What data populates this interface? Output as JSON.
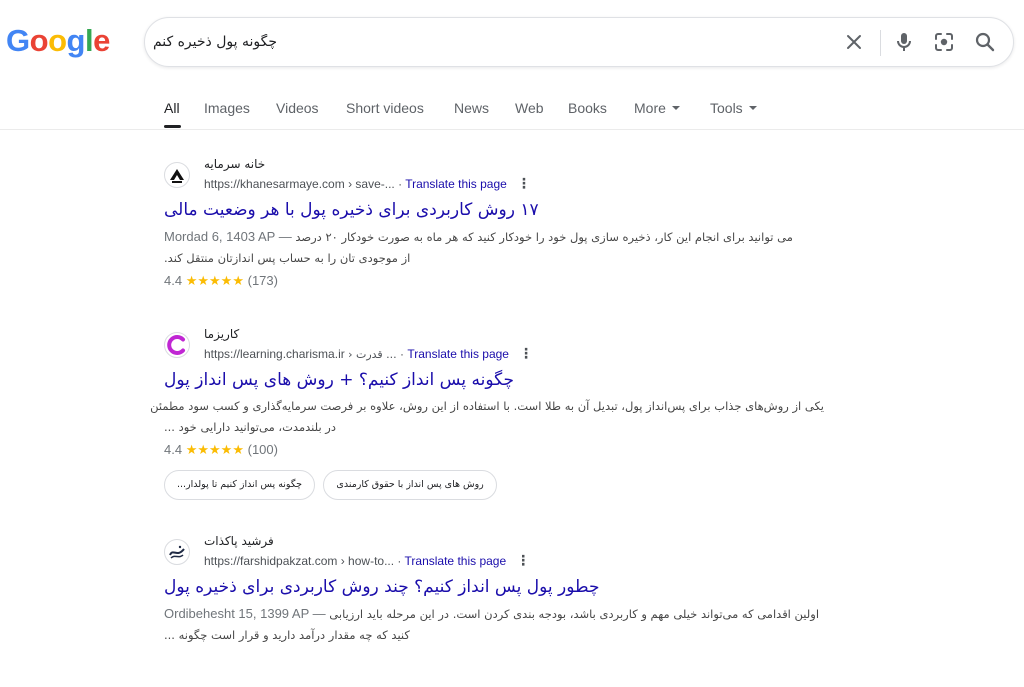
{
  "logo": {
    "text": "Google",
    "letters": [
      "G",
      "o",
      "o",
      "g",
      "l",
      "e"
    ],
    "colors": [
      "#4285F4",
      "#EA4335",
      "#FBBC05",
      "#4285F4",
      "#34A853",
      "#EA4335"
    ]
  },
  "search": {
    "query": "چگونه پول ذخیره کنم"
  },
  "icons": {
    "clear": "close-icon",
    "voice": "mic-icon",
    "lens": "camera-lens-icon",
    "search": "search-icon"
  },
  "tabs": [
    {
      "label": "All",
      "active": true
    },
    {
      "label": "Images"
    },
    {
      "label": "Videos"
    },
    {
      "label": "Short videos"
    },
    {
      "label": "News"
    },
    {
      "label": "Web"
    },
    {
      "label": "Books"
    },
    {
      "label": "More"
    },
    {
      "label": "Tools"
    }
  ],
  "results": [
    {
      "site_name": "خانه سرمایه",
      "url": "https://khanesarmaye.com › save-...",
      "translate": "Translate this page",
      "title": "۱۷ روش کاربردی برای ذخیره پول با هر وضعیت مالی",
      "date": "Mordad 6, 1403 AP",
      "snippet_line1": "می توانید برای انجام این کار، ذخیره سازی پول خود را خودکار کنید که هر ماه به صورت خودکار ۲۰ درصد",
      "snippet_line2": "از موجودی تان را به حساب پس اندازتان منتقل کند.",
      "rating": "4.4",
      "stars": "★★★★★",
      "reviews": "(173)"
    },
    {
      "site_name": "کاریزما",
      "url": "https://learning.charisma.ir",
      "crumb": "› قدرت ...",
      "translate": "Translate this page",
      "title": "چگونه پس انداز کنیم؟ + روش های پس انداز پول",
      "snippet_line1": "یکی از روش‌های جذاب برای پس‌انداز پول، تبدیل آن به طلا است. با استفاده از این روش، علاوه بر فرصت سرمایه‌گذاری و کسب سود مطمئن",
      "snippet_line2": "در بلندمدت، می‌توانید دارایی خود ...",
      "rating": "4.4",
      "stars": "★★★★★",
      "reviews": "(100)",
      "chips": [
        "چگونه پس انداز کنیم تا پولدار...",
        "روش های پس انداز با حقوق کارمندی"
      ]
    },
    {
      "site_name": "فرشید پاکذات",
      "url": "https://farshidpakzat.com › how-to...",
      "translate": "Translate this page",
      "title": "چطور پول پس انداز کنیم؟ چند روش کاربردی برای ذخیره پول",
      "date": "Ordibehesht 15, 1399 AP",
      "snippet_line1": "اولین اقدامی که می‌تواند خیلی مهم و کاربردی باشد، بودجه بندی کردن است. در این مرحله باید ارزیابی",
      "snippet_line2": "کنید که چه مقدار درآمد دارید و قرار است چگونه ..."
    }
  ]
}
